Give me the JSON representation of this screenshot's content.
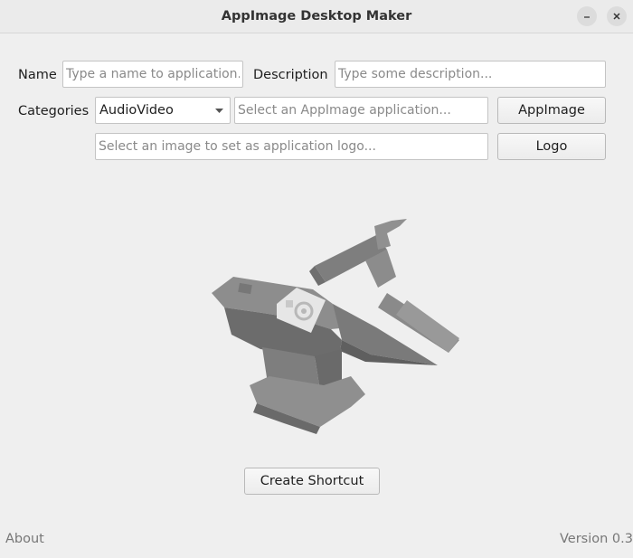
{
  "window": {
    "title": "AppImage Desktop Maker",
    "minimize_icon": "minimize-icon",
    "close_icon": "close-icon"
  },
  "form": {
    "name_label": "Name",
    "name_placeholder": "Type a name to application...",
    "description_label": "Description",
    "description_placeholder": "Type some description...",
    "categories_label": "Categories",
    "category_selected": "AudioVideo",
    "appimage_placeholder": "Select an AppImage application...",
    "appimage_button": "AppImage",
    "logo_placeholder": "Select an image to set as application logo...",
    "logo_button": "Logo"
  },
  "preview": {
    "icon": "anvil-hammer-icon"
  },
  "actions": {
    "create_button": "Create Shortcut"
  },
  "footer": {
    "about": "About",
    "version": "Version 0.3"
  }
}
